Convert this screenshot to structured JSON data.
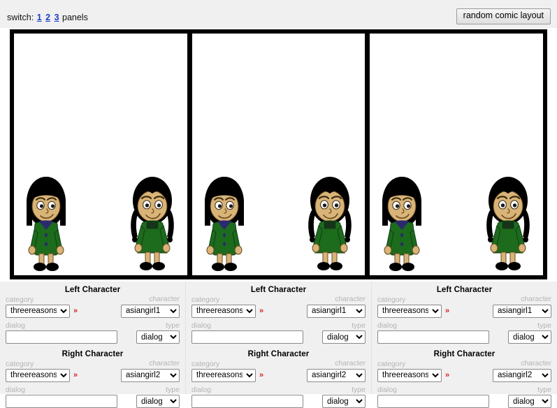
{
  "toolbar": {
    "switch_label": "switch:",
    "panels_label": "panels",
    "panel_options": [
      "1",
      "2",
      "3"
    ],
    "random_button": "random comic layout"
  },
  "labels": {
    "left_character": "Left Character",
    "right_character": "Right Character",
    "category": "category",
    "character": "character",
    "dialog": "dialog",
    "type": "type",
    "chevron": "»"
  },
  "colors": {
    "link": "#1a3fc4",
    "chevron_red": "#e01b1b",
    "panel_border": "#000000",
    "page_bg": "#f0f0f0",
    "panel_bg": "#ffffff",
    "label_grey": "#b4b4b4",
    "hair": "#000000",
    "skin": "#d8b478",
    "dress": "#1d6b1d",
    "dress_dark": "#14511b",
    "collar": "#2a2a6e"
  },
  "panels": [
    {
      "left": {
        "section": "Left Character",
        "category": "threereasons",
        "character": "asiangirl1",
        "dialog": "",
        "type": "dialog",
        "sprite": "asiangirl1"
      },
      "right": {
        "section": "Right Character",
        "category": "threereasons",
        "character": "asiangirl2",
        "dialog": "",
        "type": "dialog",
        "sprite": "asiangirl2"
      }
    },
    {
      "left": {
        "section": "Left Character",
        "category": "threereasons",
        "character": "asiangirl1",
        "dialog": "",
        "type": "dialog",
        "sprite": "asiangirl1"
      },
      "right": {
        "section": "Right Character",
        "category": "threereasons",
        "character": "asiangirl2",
        "dialog": "",
        "type": "dialog",
        "sprite": "asiangirl2"
      }
    },
    {
      "left": {
        "section": "Left Character",
        "category": "threereasons",
        "character": "asiangirl1",
        "dialog": "",
        "type": "dialog",
        "sprite": "asiangirl1"
      },
      "right": {
        "section": "Right Character",
        "category": "threereasons",
        "character": "asiangirl2",
        "dialog": "",
        "type": "dialog",
        "sprite": "asiangirl2"
      }
    }
  ],
  "select_options": {
    "category": [
      "threereasons"
    ],
    "character_left": [
      "asiangirl1"
    ],
    "character_right": [
      "asiangirl2"
    ],
    "type": [
      "dialog"
    ]
  },
  "input_placeholders": {
    "dialog": ""
  }
}
